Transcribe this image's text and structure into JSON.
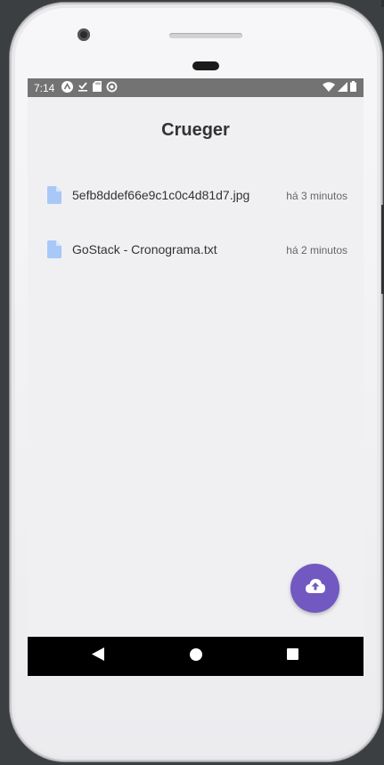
{
  "status_bar": {
    "time": "7:14",
    "left_icons": [
      "expo-icon",
      "download-done-icon",
      "sd-card-icon",
      "sync-icon"
    ],
    "right_icons": [
      "wifi-icon",
      "signal-icon",
      "battery-icon"
    ]
  },
  "app": {
    "title": "Crueger"
  },
  "files": [
    {
      "name": "5efb8ddef66e9c1c0c4d81d7.jpg",
      "time": "há 3 minutos",
      "icon": "file-icon"
    },
    {
      "name": "GoStack - Cronograma.txt",
      "time": "há 2 minutos",
      "icon": "file-icon"
    }
  ],
  "fab": {
    "icon": "cloud-upload-icon",
    "color": "#7159c1"
  },
  "nav_bar": {
    "buttons": [
      "back-icon",
      "home-icon",
      "recents-icon"
    ]
  },
  "colors": {
    "accent": "#7159c1",
    "file_icon": "#a8c8f8",
    "background": "#f0f0f2"
  }
}
